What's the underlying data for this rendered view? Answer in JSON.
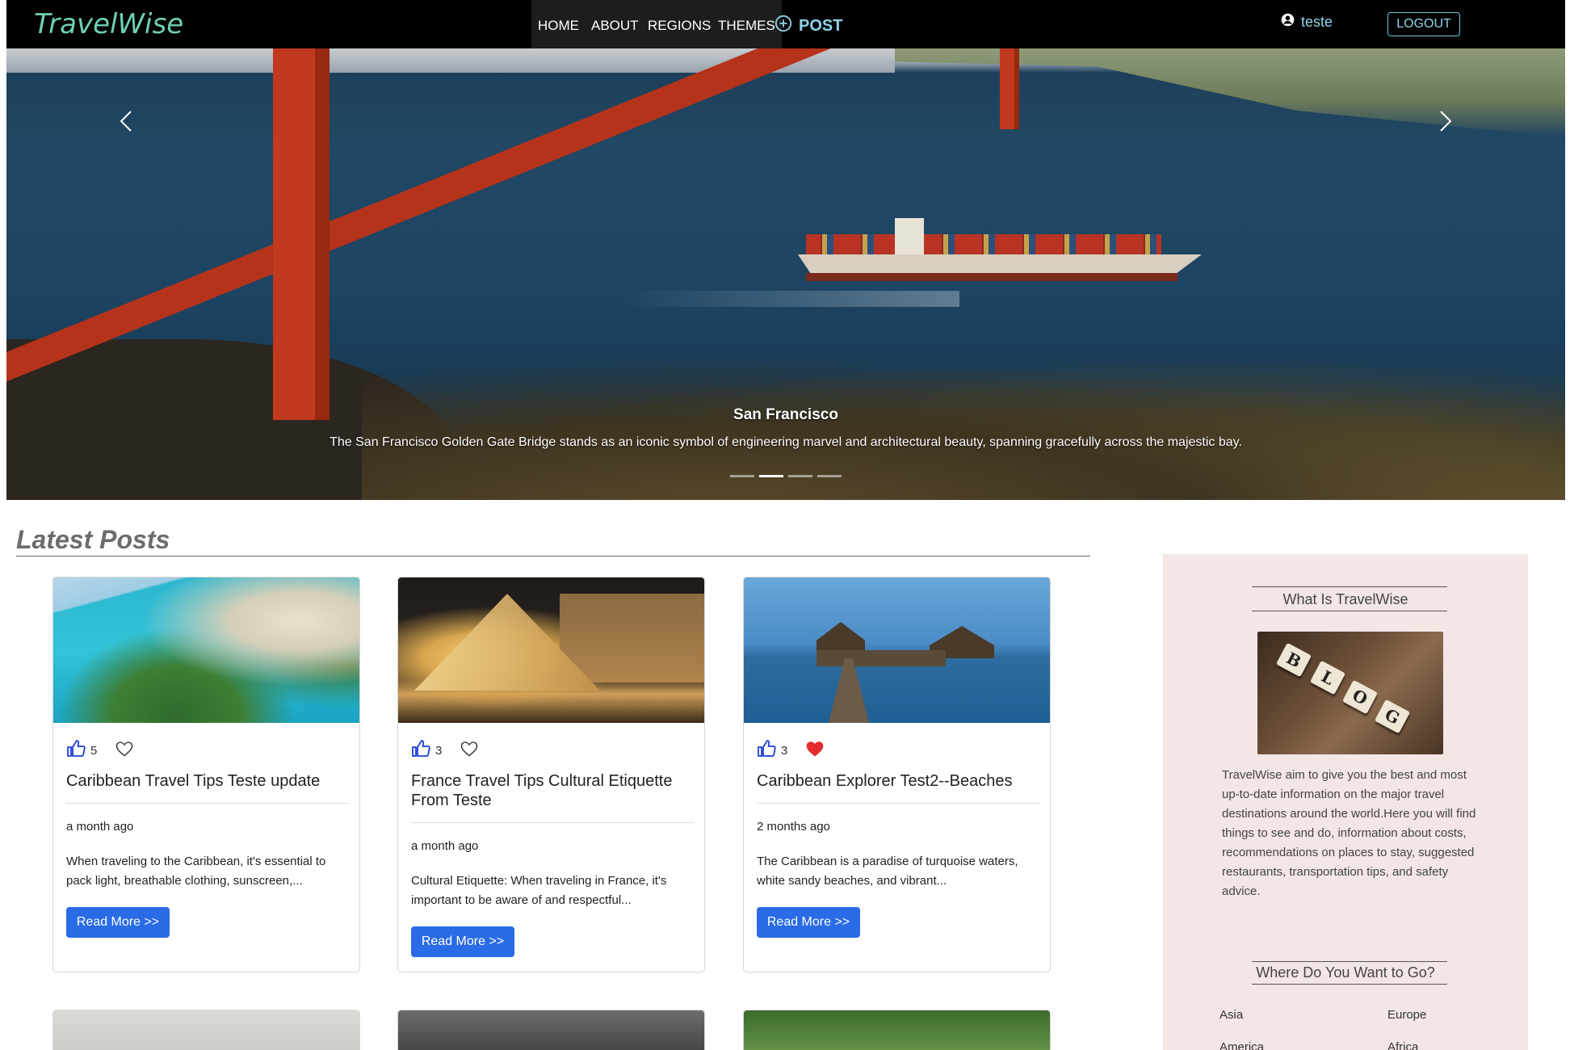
{
  "brand": "TravelWise",
  "nav": {
    "home": "HOME",
    "about": "ABOUT",
    "regions": "REGIONS",
    "themes": "THEMES",
    "post": "POST"
  },
  "user": {
    "name": "teste",
    "logout_label": "LOGOUT"
  },
  "carousel": {
    "title": "San Francisco",
    "caption": "The San Francisco Golden Gate Bridge stands as an iconic symbol of engineering marvel and architectural beauty, spanning gracefully across the majestic bay.",
    "indicator_count": 4,
    "active_index": 1
  },
  "latest": {
    "heading": "Latest Posts",
    "posts": [
      {
        "likes": "5",
        "favorited": false,
        "title": "Caribbean Travel Tips Teste update",
        "date": "a month ago",
        "excerpt": "When traveling to the Caribbean, it's essential to pack light, breathable clothing, sunscreen,...",
        "read_more": "Read More >>"
      },
      {
        "likes": "3",
        "favorited": false,
        "title": "France Travel Tips Cultural Etiquette From Teste",
        "date": "a month ago",
        "excerpt": "Cultural Etiquette: When traveling in France, it's important to be aware of and respectful...",
        "read_more": "Read More >>"
      },
      {
        "likes": "3",
        "favorited": true,
        "title": "Caribbean Explorer Test2--Beaches",
        "date": "2 months ago",
        "excerpt": "The Caribbean is a paradise of turquoise waters, white sandy beaches, and vibrant...",
        "read_more": "Read More >>"
      }
    ]
  },
  "sidebar": {
    "about_heading": "What Is TravelWise",
    "about_text": "TravelWise aim to give you the best and most up-to-date information on the major travel destinations around the world.Here you will find things to see and do, information about costs, recommendations on places to stay, suggested restaurants, transportation tips, and safety advice.",
    "regions_heading": "Where Do You Want to Go?",
    "regions": [
      "Asia",
      "Europe",
      "America",
      "Africa"
    ]
  },
  "colors": {
    "navbar": "#000000",
    "brand": "#6fcfb6",
    "accent_button": "#2a6be6",
    "like_icon": "#1a3ed6",
    "heart_filled": "#e52b2b",
    "sidebar_bg": "#f3e6e5"
  },
  "icons": {
    "post": "plus-circle-icon",
    "user": "user-circle-icon",
    "prev": "chevron-left-icon",
    "next": "chevron-right-icon",
    "like": "thumbs-up-icon",
    "favorite": "heart-icon"
  }
}
